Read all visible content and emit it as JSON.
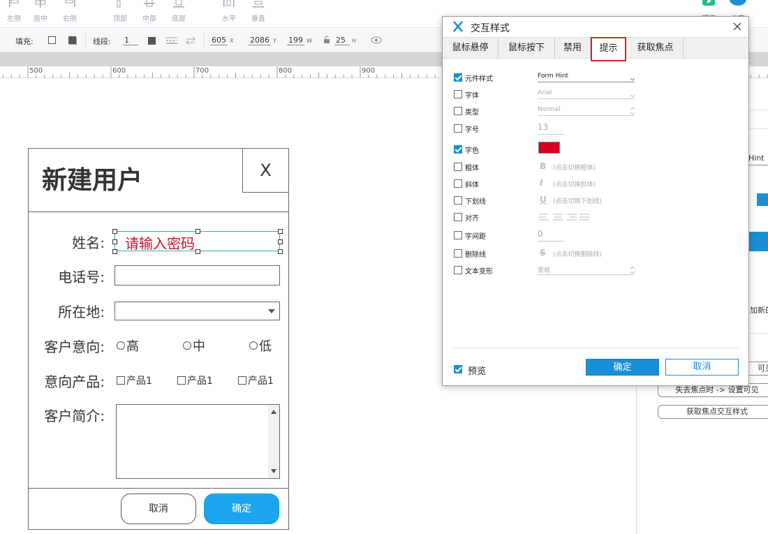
{
  "toolbar": {
    "align_left": "左侧",
    "align_center": "居中",
    "align_right": "右侧",
    "align_top": "顶部",
    "align_middle": "中部",
    "align_bottom": "底部",
    "distribute_h": "水平",
    "distribute_v": "垂直",
    "preview": "预览",
    "share": "共享"
  },
  "props": {
    "fill_label": "填充:",
    "line_label": "线段:",
    "line_width": "1",
    "x": "605",
    "x_unit": "X",
    "y": "2086",
    "y_unit": "Y",
    "w": "199",
    "w_unit": "W",
    "h": "25",
    "h_unit": "H"
  },
  "ruler": {
    "labels": [
      "500",
      "600",
      "700",
      "800",
      "900"
    ]
  },
  "side_panel": {
    "hint_value": "Hint",
    "add_new_text": "加新的",
    "btn1": "获取焦点时 -> 设置可见",
    "btn2": "失去焦点时 -> 设置可见",
    "btn3": "获取焦点交互样式",
    "btn1_visible": "可见"
  },
  "form": {
    "title": "新建用户",
    "close": "X",
    "name_label": "姓名:",
    "name_hint": "请输入密码",
    "phone_label": "电话号:",
    "location_label": "所在地:",
    "intent_label": "客户意向:",
    "intent_options": [
      "高",
      "中",
      "低"
    ],
    "product_label": "意向产品:",
    "product_options": [
      "产品1",
      "产品1",
      "产品1"
    ],
    "intro_label": "客户简介:",
    "cancel": "取消",
    "ok": "确定"
  },
  "dialog": {
    "title": "交互样式",
    "tabs": [
      "鼠标悬停",
      "鼠标按下",
      "禁用",
      "提示",
      "获取焦点"
    ],
    "active_tab": "提示",
    "rows": {
      "widget_style": {
        "label": "元件样式",
        "value": "Form Hint",
        "checked": true
      },
      "font": {
        "label": "字体",
        "value": "Arial",
        "checked": false
      },
      "type": {
        "label": "类型",
        "value": "Normal",
        "checked": false
      },
      "size": {
        "label": "字号",
        "value": "13",
        "checked": false
      },
      "color": {
        "label": "字色",
        "checked": true,
        "swatch": "#d6001c"
      },
      "bold": {
        "label": "粗体",
        "note": "(点击切换粗体)",
        "checked": false
      },
      "italic": {
        "label": "斜体",
        "note": "(点击切换斜体)",
        "checked": false
      },
      "underline": {
        "label": "下划线",
        "note": "(点击切换下划线)",
        "checked": false
      },
      "align": {
        "label": "对齐",
        "checked": false
      },
      "spacing": {
        "label": "字间距",
        "value": "0",
        "checked": false
      },
      "strike": {
        "label": "删除线",
        "note": "(点击切换删除线)",
        "checked": false
      },
      "transform": {
        "label": "文本变形",
        "value": "常规",
        "checked": false
      }
    },
    "preview": "预览",
    "ok": "确定",
    "cancel": "取消"
  },
  "colors": {
    "accent": "#1a8fd6",
    "hint_red": "#c8102e",
    "selection": "#2ab3a9",
    "ok_button": "#19a6ef"
  }
}
